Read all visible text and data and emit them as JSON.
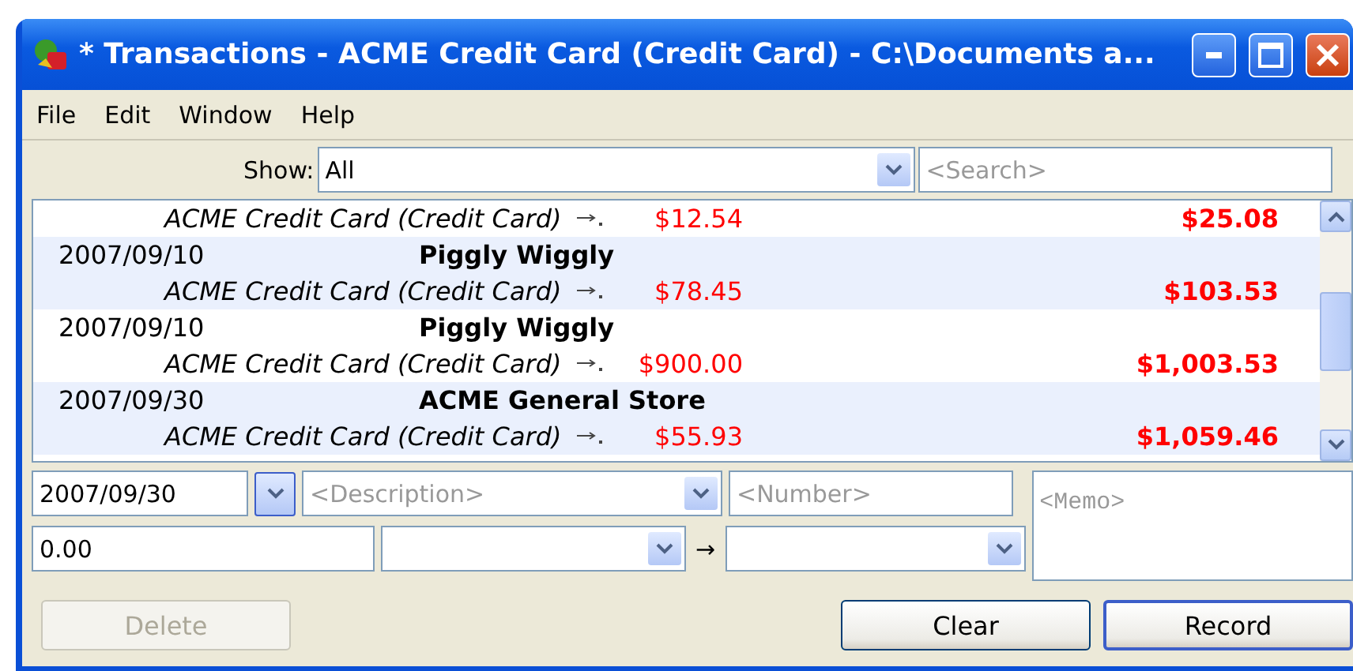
{
  "window": {
    "title": "* Transactions - ACME Credit Card (Credit Card) - C:\\Documents a..."
  },
  "menu": [
    "File",
    "Edit",
    "Window",
    "Help"
  ],
  "filter": {
    "label": "Show:",
    "value": "All",
    "search_placeholder": "<Search>"
  },
  "transactions": [
    {
      "account": "ACME Credit Card (Credit Card)",
      "amount": "$12.54",
      "balance": "$25.08"
    },
    {
      "date": "2007/09/10",
      "description": "Piggly Wiggly",
      "account": "ACME Credit Card (Credit Card)",
      "amount": "$78.45",
      "balance": "$103.53"
    },
    {
      "date": "2007/09/10",
      "description": "Piggly Wiggly",
      "account": "ACME Credit Card (Credit Card)",
      "amount": "$900.00",
      "balance": "$1,003.53"
    },
    {
      "date": "2007/09/30",
      "description": "ACME General Store",
      "account": "ACME Credit Card (Credit Card)",
      "amount": "$55.93",
      "balance": "$1,059.46"
    }
  ],
  "form": {
    "date": "2007/09/30",
    "description_placeholder": "<Description>",
    "number_placeholder": "<Number>",
    "memo_placeholder": "<Memo>",
    "amount": "0.00",
    "transfer_arrow": "→"
  },
  "buttons": [
    {
      "label": "Delete",
      "disabled": true,
      "default": false
    },
    {
      "label": "Clear",
      "disabled": false,
      "default": false
    },
    {
      "label": "Record",
      "disabled": false,
      "default": true
    }
  ]
}
